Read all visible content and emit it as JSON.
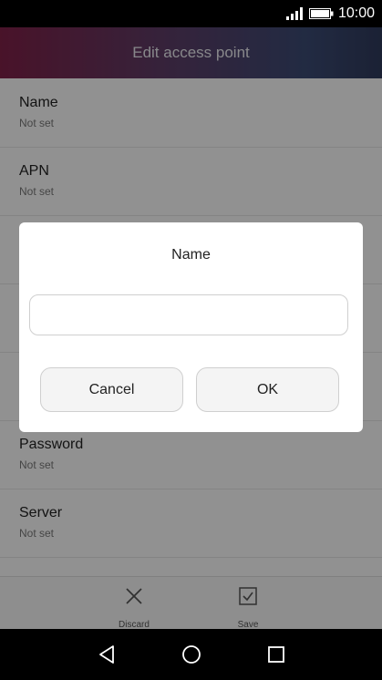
{
  "status_bar": {
    "time": "10:00"
  },
  "header": {
    "title": "Edit access point"
  },
  "list": {
    "items": [
      {
        "label": "Name",
        "value": "Not set"
      },
      {
        "label": "APN",
        "value": "Not set"
      },
      {
        "label": "",
        "value": ""
      },
      {
        "label": "",
        "value": ""
      },
      {
        "label": "",
        "value": ""
      },
      {
        "label": "Password",
        "value": "Not set"
      },
      {
        "label": "Server",
        "value": "Not set"
      }
    ]
  },
  "dialog": {
    "title": "Name",
    "input_value": "",
    "cancel_label": "Cancel",
    "ok_label": "OK"
  },
  "bottom_bar": {
    "discard_label": "Discard",
    "save_label": "Save"
  }
}
